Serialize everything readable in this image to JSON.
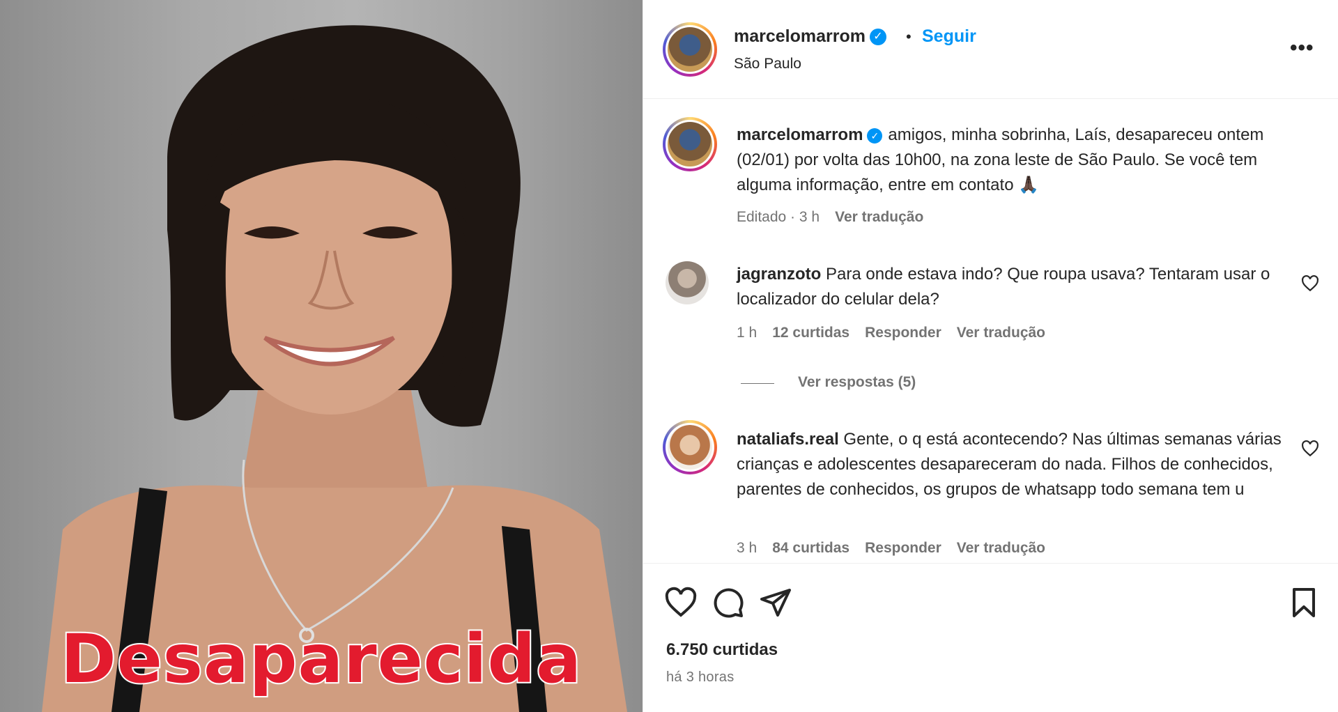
{
  "post": {
    "username": "marcelomarrom",
    "follow_label": "Seguir",
    "separator": "•",
    "location": "São Paulo",
    "more_label": "•••",
    "overlay_text": "Desaparecida"
  },
  "caption": {
    "username": "marcelomarrom",
    "text": "amigos, minha sobrinha, Laís, desapareceu ontem (02/01) por volta das 10h00, na zona leste de São Paulo. Se você tem alguma informação, entre em contato 🙏🏿",
    "edited": "Editado · 3 h",
    "translate": "Ver tradução"
  },
  "comments": [
    {
      "username": "jagranzoto",
      "text": "Para onde estava indo? Que roupa usava? Tentaram usar o localizador do celular dela?",
      "time": "1 h",
      "likes": "12 curtidas",
      "reply": "Responder",
      "translate": "Ver tradução",
      "view_replies": "Ver respostas (5)"
    },
    {
      "username": "nataliafs.real",
      "text": "Gente, o q está acontecendo? Nas últimas semanas várias crianças e adolescentes desapareceram do nada. Filhos de conhecidos, parentes de conhecidos, os grupos de whatsapp todo semana tem u",
      "time": "3 h",
      "likes": "84 curtidas",
      "reply": "Responder",
      "translate": "Ver tradução"
    }
  ],
  "footer": {
    "likes": "6.750 curtidas",
    "posted": "há 3 horas"
  },
  "icons": {
    "verified": "verified-badge-icon",
    "like": "heart-icon",
    "comment": "comment-bubble-icon",
    "share": "paper-plane-icon",
    "save": "bookmark-icon"
  },
  "colors": {
    "accent": "#0095f6",
    "overlay_text": "#e31b2e",
    "meta": "#737373"
  }
}
